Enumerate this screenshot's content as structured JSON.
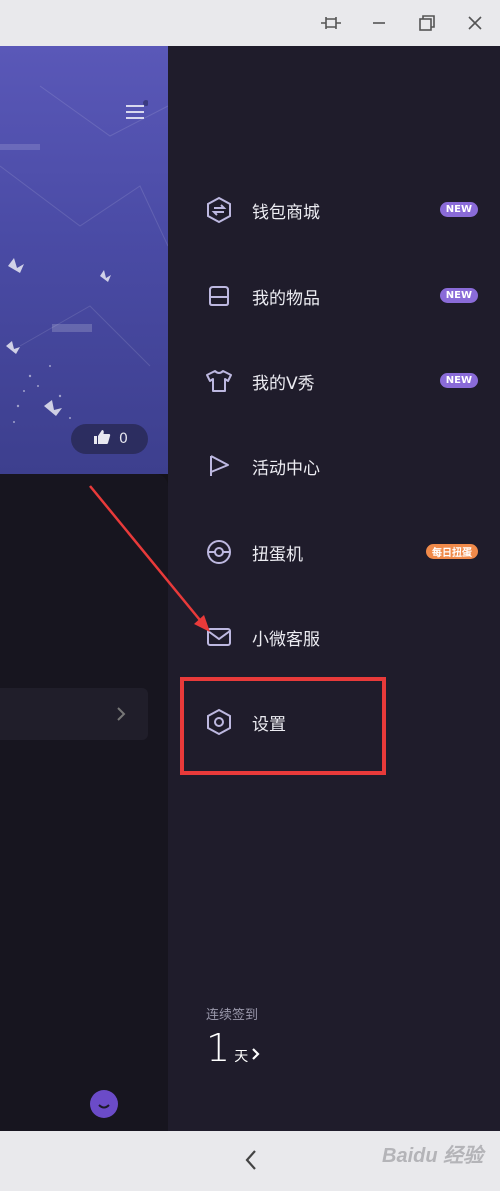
{
  "window": {
    "controls": [
      "pin-icon",
      "minimize-icon",
      "restore-icon",
      "close-icon"
    ]
  },
  "left_panel": {
    "like_count": "0"
  },
  "drawer": {
    "items": [
      {
        "label": "钱包商城",
        "icon": "wallet-icon",
        "badge": "NEW"
      },
      {
        "label": "我的物品",
        "icon": "inbox-icon",
        "badge": "NEW"
      },
      {
        "label": "我的V秀",
        "icon": "shirt-icon",
        "badge": "NEW"
      },
      {
        "label": "活动中心",
        "icon": "flag-icon",
        "badge": ""
      },
      {
        "label": "扭蛋机",
        "icon": "capsule-icon",
        "badge": "每日扭蛋"
      },
      {
        "label": "小微客服",
        "icon": "mail-icon",
        "badge": ""
      },
      {
        "label": "设置",
        "icon": "settings-icon",
        "badge": ""
      }
    ],
    "checkin": {
      "label": "连续签到",
      "days": "1",
      "unit": "天"
    }
  },
  "bottom": {
    "watermark": "Baidu 经验"
  },
  "colors": {
    "accent_badge": "#8a6bd8",
    "orange_badge": "#f08a4a",
    "highlight": "#e83a3a"
  }
}
